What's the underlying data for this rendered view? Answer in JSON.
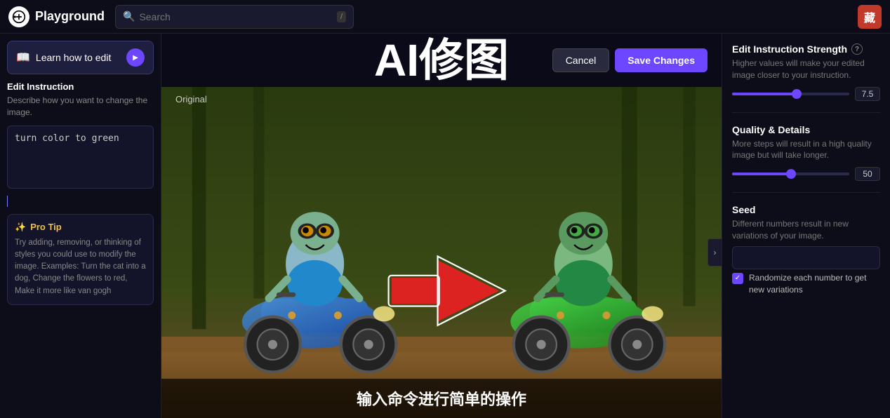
{
  "topnav": {
    "logo_text": "Playground",
    "search_placeholder": "Search",
    "search_shortcut": "/",
    "user_avatar_text": "藏"
  },
  "left_sidebar": {
    "learn_btn_label": "Learn how to edit",
    "edit_instruction_title": "Edit Instruction",
    "edit_instruction_desc": "Describe how you want to change the image.",
    "instruction_value": "turn color to green",
    "pro_tip_header": "Pro Tip",
    "pro_tip_text": "Try adding, removing, or thinking of styles you could use to modify the image. Examples: Turn the cat into a dog, Change the flowers to red, Make it more like van gogh"
  },
  "center": {
    "ai_title": "AI修图",
    "cancel_label": "Cancel",
    "save_label": "Save Changes",
    "original_label": "Original",
    "bottom_caption": "输入命令进行简单的操作"
  },
  "right_panel": {
    "strength_title": "Edit Instruction Strength",
    "strength_desc": "Higher values will make your edited image closer to your instruction.",
    "strength_value": "7.5",
    "strength_pct": 55,
    "quality_title": "Quality & Details",
    "quality_desc": "More steps will result in a high quality image but will take longer.",
    "quality_value": "50",
    "quality_pct": 50,
    "seed_title": "Seed",
    "seed_desc": "Different numbers result in new variations of your image.",
    "seed_value": "",
    "randomize_label": "Randomize each number to get new variations",
    "randomize_checked": true
  }
}
